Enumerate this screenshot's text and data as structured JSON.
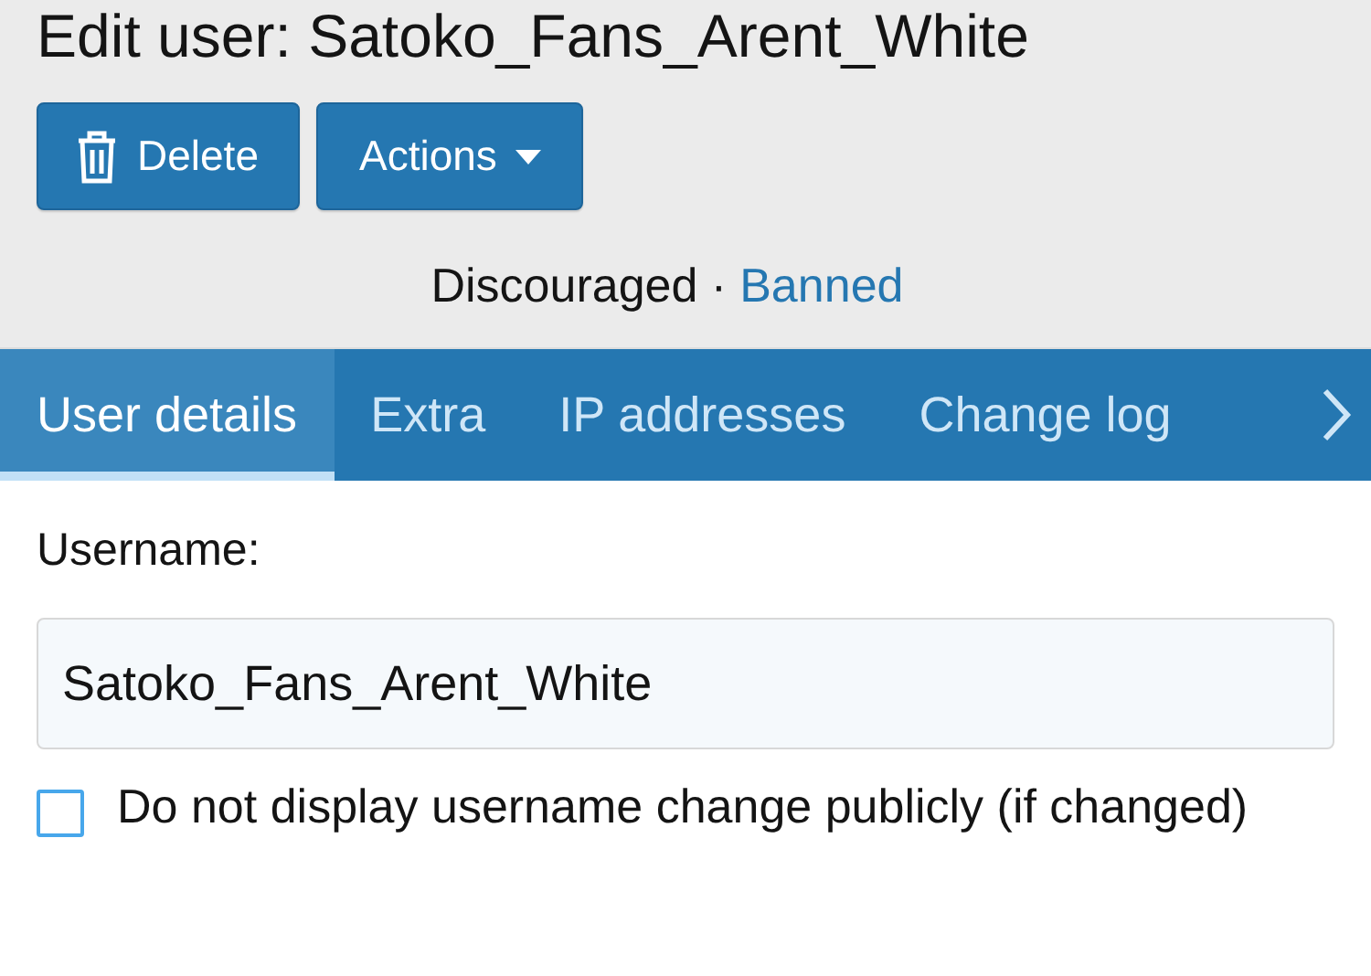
{
  "title": "Edit user: Satoko_Fans_Arent_White",
  "buttons": [
    {
      "kind": "delete",
      "label": "Delete"
    },
    {
      "kind": "dropdown",
      "label": "Actions"
    }
  ],
  "status": {
    "text": "Discouraged ·",
    "link": "Banned"
  },
  "tabs": [
    {
      "label": "User details",
      "selected": true
    },
    {
      "label": "Extra",
      "selected": false
    },
    {
      "label": "IP addresses",
      "selected": false
    },
    {
      "label": "Change log",
      "selected": false
    }
  ],
  "form": {
    "username_label": "Username:",
    "username_value": "Satoko_Fans_Arent_White",
    "checkbox": {
      "label": "Do not display username change publicly (if changed)",
      "checked": false
    }
  }
}
